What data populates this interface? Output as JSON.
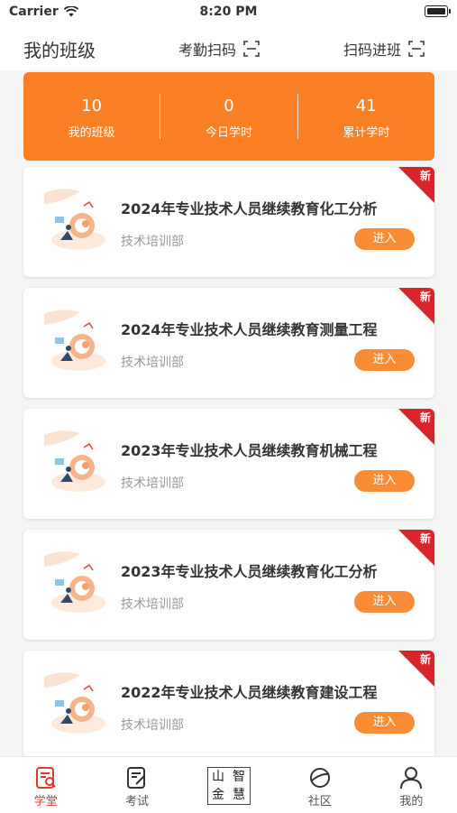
{
  "status_bar": {
    "carrier": "Carrier",
    "time": "8:20 PM"
  },
  "header": {
    "title": "我的班级",
    "attendance_scan": "考勤扫码",
    "join_scan": "扫码进班"
  },
  "stats": [
    {
      "value": "10",
      "label": "我的班级"
    },
    {
      "value": "0",
      "label": "今日学时"
    },
    {
      "value": "41",
      "label": "累计学时"
    }
  ],
  "courses": [
    {
      "title": "2024年专业技术人员继续教育化工分析",
      "dept": "技术培训部",
      "badge": "新",
      "action": "进入"
    },
    {
      "title": "2024年专业技术人员继续教育测量工程",
      "dept": "技术培训部",
      "badge": "新",
      "action": "进入"
    },
    {
      "title": "2023年专业技术人员继续教育机械工程",
      "dept": "技术培训部",
      "badge": "新",
      "action": "进入"
    },
    {
      "title": "2023年专业技术人员继续教育化工分析",
      "dept": "技术培训部",
      "badge": "新",
      "action": "进入"
    },
    {
      "title": "2022年专业技术人员继续教育建设工程",
      "dept": "技术培训部",
      "badge": "新",
      "action": "进入"
    }
  ],
  "logo_chars": [
    "山",
    "智",
    "金",
    "慧"
  ],
  "tabs": [
    {
      "label": "学堂",
      "icon": "study-icon",
      "active": true
    },
    {
      "label": "考试",
      "icon": "exam-icon",
      "active": false
    },
    {
      "label": "",
      "icon": "logo",
      "active": false
    },
    {
      "label": "社区",
      "icon": "community-icon",
      "active": false
    },
    {
      "label": "我的",
      "icon": "profile-icon",
      "active": false
    }
  ],
  "colors": {
    "accent": "#fb7f24",
    "button": "#fa8c35",
    "badge": "#d9252a",
    "active_tab": "#e0382a"
  }
}
